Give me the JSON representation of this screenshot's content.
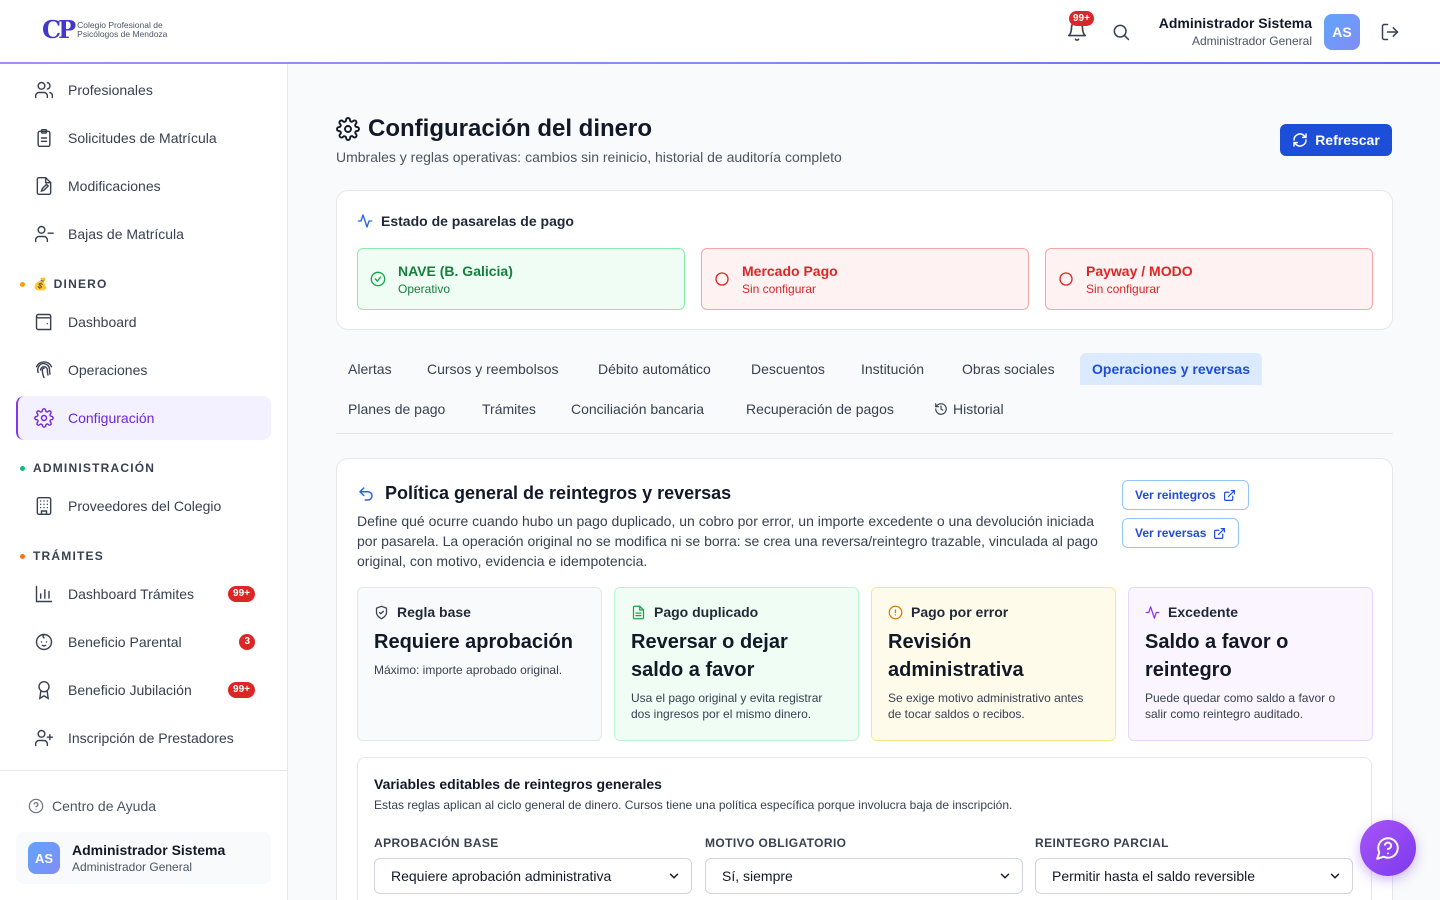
{
  "brand": {
    "name_line1": "Colegio Profesional de",
    "name_line2": "Psicólogos de Mendoza",
    "mark": "CP"
  },
  "topbar": {
    "notifications_badge": "99+",
    "user_name": "Administrador Sistema",
    "user_role": "Administrador General",
    "avatar_initials": "AS"
  },
  "sidebar": {
    "items": [
      {
        "label": "Profesionales",
        "icon": "users-icon"
      },
      {
        "label": "Solicitudes de Matrícula",
        "icon": "clipboard-icon"
      },
      {
        "label": "Modificaciones",
        "icon": "file-edit-icon"
      },
      {
        "label": "Bajas de Matrícula",
        "icon": "user-minus-icon"
      },
      {
        "label": "Dashboard",
        "icon": "wallet-icon"
      },
      {
        "label": "Operaciones",
        "icon": "fingerprint-icon"
      },
      {
        "label": "Configuración",
        "icon": "gear-icon",
        "active": true
      },
      {
        "label": "Proveedores del Colegio",
        "icon": "building-icon"
      },
      {
        "label": "Dashboard Trámites",
        "icon": "bar-chart-icon",
        "badge": "99+"
      },
      {
        "label": "Beneficio Parental",
        "icon": "baby-icon",
        "badge": "3"
      },
      {
        "label": "Beneficio Jubilación",
        "icon": "award-icon",
        "badge": "99+"
      },
      {
        "label": "Inscripción de Prestadores",
        "icon": "user-plus-icon"
      }
    ],
    "sections": {
      "dinero": "💰 DINERO",
      "administracion": "ADMINISTRACIÓN",
      "tramites": "TRÁMITES"
    },
    "section_colors": {
      "dinero": "#f59e0b",
      "administracion": "#10b981",
      "tramites": "#f97316"
    },
    "help": "Centro de Ayuda",
    "user_name": "Administrador Sistema",
    "user_role": "Administrador General",
    "avatar_initials": "AS"
  },
  "page": {
    "title": "Configuración del dinero",
    "subtitle": "Umbrales y reglas operativas: cambios sin reinicio, historial de auditoría completo",
    "refresh_label": "Refrescar"
  },
  "gateways": {
    "title": "Estado de pasarelas de pago",
    "items": [
      {
        "name": "NAVE (B. Galicia)",
        "status": "Operativo",
        "state": "ok"
      },
      {
        "name": "Mercado Pago",
        "status": "Sin configurar",
        "state": "bad"
      },
      {
        "name": "Payway / MODO",
        "status": "Sin configurar",
        "state": "bad"
      }
    ]
  },
  "tabs": [
    {
      "label": "Alertas"
    },
    {
      "label": "Cursos y reembolsos"
    },
    {
      "label": "Débito automático"
    },
    {
      "label": "Descuentos"
    },
    {
      "label": "Institución"
    },
    {
      "label": "Obras sociales"
    },
    {
      "label": "Operaciones y reversas",
      "active": true
    },
    {
      "label": "Planes de pago"
    },
    {
      "label": "Trámites"
    },
    {
      "label": "Conciliación bancaria"
    },
    {
      "label": "Recuperación de pagos"
    },
    {
      "label": "Historial"
    }
  ],
  "policy": {
    "title": "Política general de reintegros y reversas",
    "description": "Define qué ocurre cuando hubo un pago duplicado, un cobro por error, un importe excedente o una devolución iniciada por pasarela. La operación original no se modifica ni se borra: se crea una reversa/reintegro trazable, vinculada al pago original, con motivo, evidencia e idempotencia.",
    "link_refunds": "Ver reintegros",
    "link_reversals": "Ver reversas",
    "rules": [
      {
        "title": "Regla base",
        "value": "Requiere aprobación",
        "desc": "Máximo: importe aprobado original.",
        "bg": "#f9fafb",
        "border": "#e5e7eb",
        "icon_color": "#374151"
      },
      {
        "title": "Pago duplicado",
        "value": "Reversar o dejar saldo a favor",
        "desc": "Usa el pago original y evita registrar dos ingresos por el mismo dinero.",
        "bg": "#f0fdf4",
        "border": "#bbf7d0",
        "icon_color": "#16a34a"
      },
      {
        "title": "Pago por error",
        "value": "Revisión administrativa",
        "desc": "Se exige motivo administrativo antes de tocar saldos o recibos.",
        "bg": "#fffbeb",
        "border": "#fde68a",
        "icon_color": "#d97706"
      },
      {
        "title": "Excedente",
        "value": "Saldo a favor o reintegro",
        "desc": "Puede quedar como saldo a favor o salir como reintegro auditado.",
        "bg": "#faf5ff",
        "border": "#e9d5ff",
        "icon_color": "#9333ea"
      }
    ],
    "vars": {
      "title": "Variables editables de reintegros generales",
      "desc": "Estas reglas aplican al ciclo general de dinero. Cursos tiene una política específica porque involucra baja de inscripción.",
      "fields": [
        {
          "label": "APROBACIÓN BASE",
          "value": "Requiere aprobación administrativa"
        },
        {
          "label": "MOTIVO OBLIGATORIO",
          "value": "Sí, siempre"
        },
        {
          "label": "REINTEGRO PARCIAL",
          "value": "Permitir hasta el saldo reversible"
        }
      ]
    }
  }
}
